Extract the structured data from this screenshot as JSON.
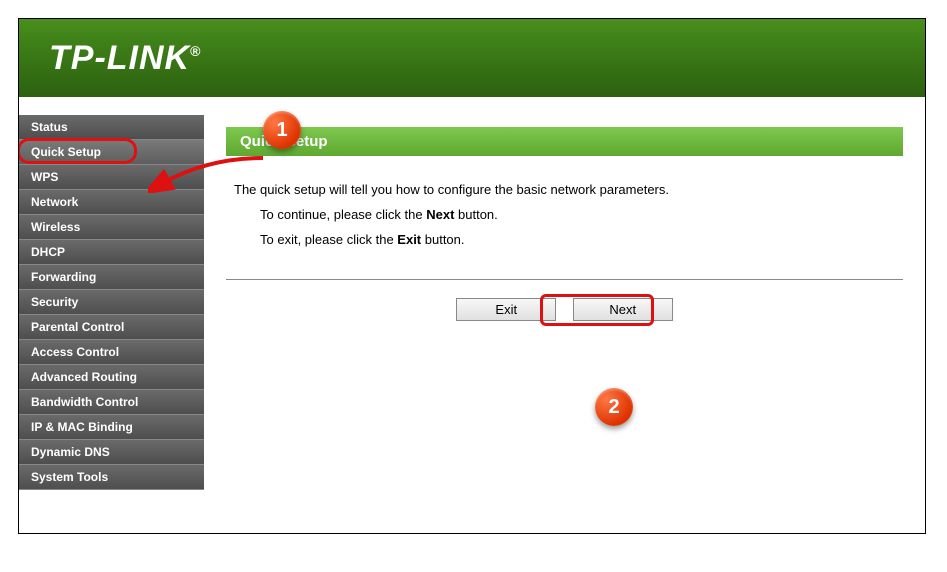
{
  "header": {
    "logo_text": "TP-LINK"
  },
  "sidebar": {
    "items": [
      {
        "label": "Status"
      },
      {
        "label": "Quick Setup",
        "selected": true
      },
      {
        "label": "WPS"
      },
      {
        "label": "Network"
      },
      {
        "label": "Wireless"
      },
      {
        "label": "DHCP"
      },
      {
        "label": "Forwarding"
      },
      {
        "label": "Security"
      },
      {
        "label": "Parental Control"
      },
      {
        "label": "Access Control"
      },
      {
        "label": "Advanced Routing"
      },
      {
        "label": "Bandwidth Control"
      },
      {
        "label": "IP & MAC Binding"
      },
      {
        "label": "Dynamic DNS"
      },
      {
        "label": "System Tools"
      }
    ]
  },
  "main": {
    "title": "Quick Setup",
    "line1": "The quick setup will tell you how to configure the basic network parameters.",
    "line2_prefix": "To continue, please click the ",
    "line2_bold": "Next",
    "line2_suffix": " button.",
    "line3_prefix": "To exit, please click the ",
    "line3_bold": "Exit",
    "line3_suffix": " button.",
    "buttons": {
      "exit": "Exit",
      "next": "Next"
    }
  },
  "annotations": {
    "callout1": "1",
    "callout2": "2"
  }
}
